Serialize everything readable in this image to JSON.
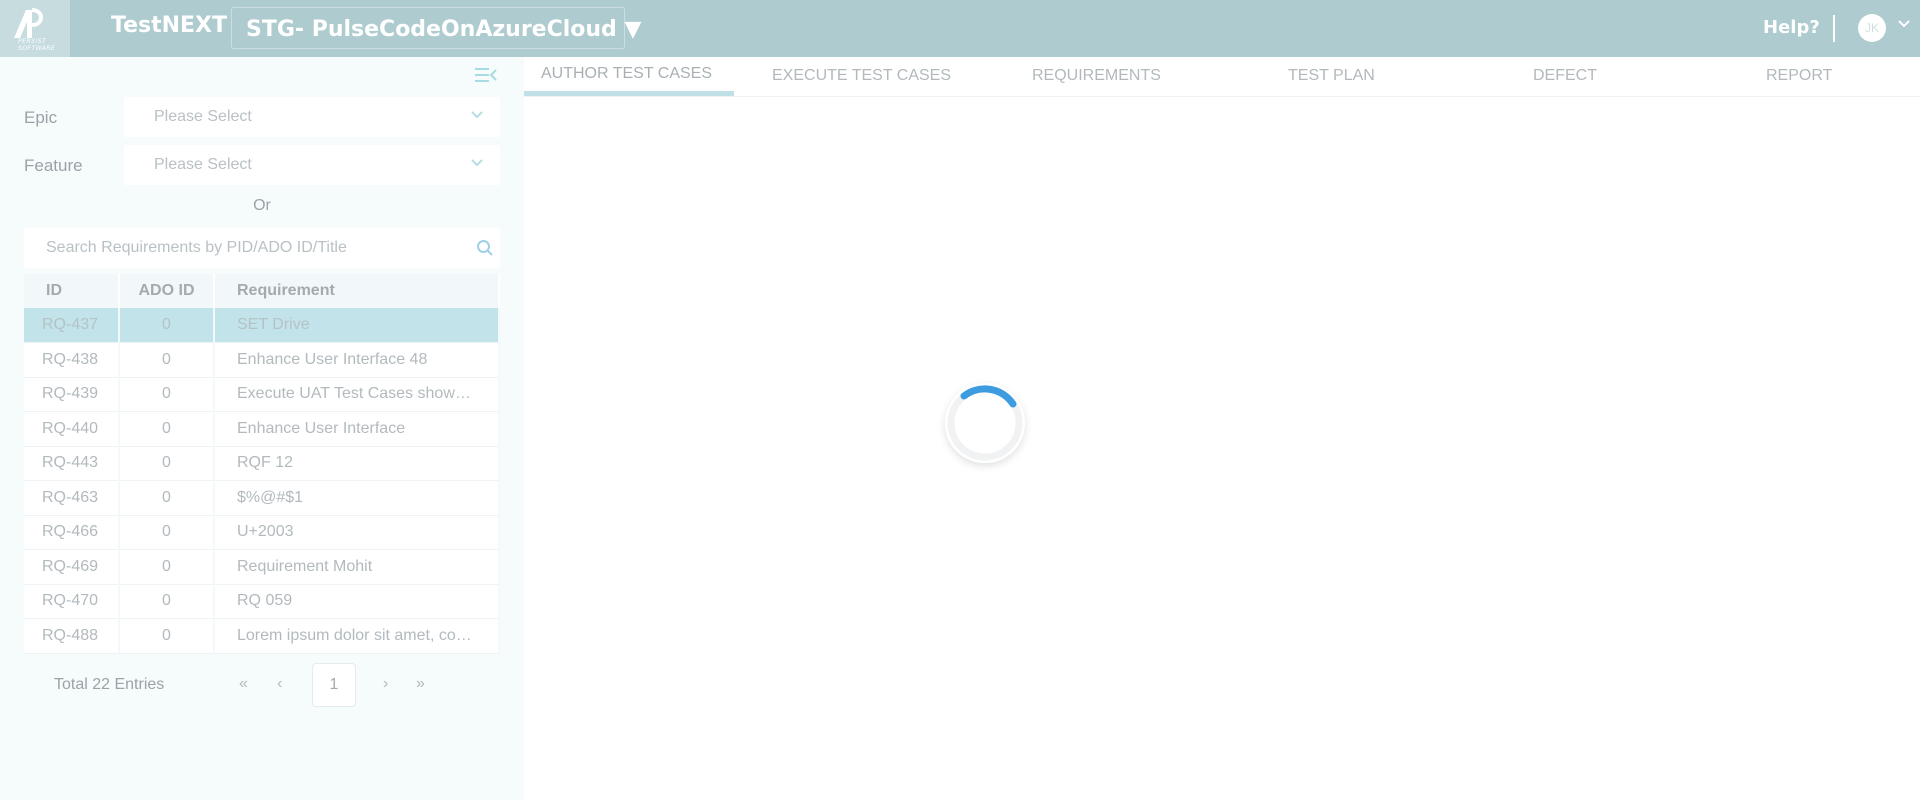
{
  "header": {
    "logo_text": "PERSIST SOFTWARE",
    "app_name": "TestNEXT",
    "project": "STG- PulseCodeOnAzureCloud ▼",
    "help": "Help?",
    "user_initials": "JK"
  },
  "sidebar": {
    "epic": {
      "label": "Epic",
      "placeholder": "Please Select"
    },
    "feature": {
      "label": "Feature",
      "placeholder": "Please Select"
    },
    "or_text": "Or",
    "search_placeholder": "Search Requirements by PID/ADO ID/Title",
    "table": {
      "headers": [
        "ID",
        "ADO ID",
        "Requirement"
      ],
      "rows": [
        {
          "id": "RQ-437",
          "ado": "0",
          "req": "SET Drive",
          "selected": true
        },
        {
          "id": "RQ-438",
          "ado": "0",
          "req": "Enhance User Interface 48"
        },
        {
          "id": "RQ-439",
          "ado": "0",
          "req": "Execute UAT Test Cases show…"
        },
        {
          "id": "RQ-440",
          "ado": "0",
          "req": "Enhance User Interface"
        },
        {
          "id": "RQ-443",
          "ado": "0",
          "req": "RQF 12"
        },
        {
          "id": "RQ-463",
          "ado": "0",
          "req": "$%@#$1"
        },
        {
          "id": "RQ-466",
          "ado": "0",
          "req": "U+2003"
        },
        {
          "id": "RQ-469",
          "ado": "0",
          "req": "Requirement Mohit"
        },
        {
          "id": "RQ-470",
          "ado": "0",
          "req": "RQ 059"
        },
        {
          "id": "RQ-488",
          "ado": "0",
          "req": "Lorem ipsum dolor sit amet, co…"
        }
      ]
    },
    "pagination": {
      "total": "Total 22 Entries",
      "first": "«",
      "prev": "‹",
      "current_page": "1",
      "next": "›",
      "last": "»"
    }
  },
  "tabs": [
    {
      "label": "AUTHOR TEST CASES",
      "active": true
    },
    {
      "label": "EXECUTE TEST CASES"
    },
    {
      "label": "REQUIREMENTS"
    },
    {
      "label": "TEST PLAN"
    },
    {
      "label": "DEFECT"
    },
    {
      "label": "REPORT"
    }
  ],
  "colors": {
    "header_bg": "#aecbcf",
    "accent": "#3d9be0",
    "selected_row": "#c2e3e9"
  }
}
